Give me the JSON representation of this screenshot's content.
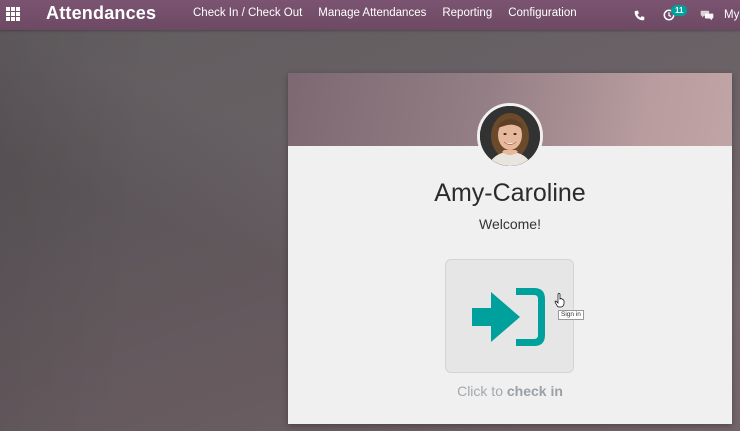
{
  "navbar": {
    "app_title": "Attendances",
    "menu": [
      {
        "label": "Check In / Check Out"
      },
      {
        "label": "Manage Attendances"
      },
      {
        "label": "Reporting"
      },
      {
        "label": "Configuration"
      }
    ],
    "activity_count": "11",
    "user_label": "My"
  },
  "card": {
    "employee_name": "Amy-Caroline",
    "welcome": "Welcome!",
    "hint_prefix": "Click to ",
    "hint_action": "check in",
    "tooltip": "Sign in"
  },
  "colors": {
    "navbar": "#714B67",
    "accent_teal": "#00A09D",
    "badge": "#00A09D"
  },
  "icons": {
    "apps": "apps-grid-icon",
    "phone": "phone-icon",
    "activity": "clock-icon",
    "chat": "chat-icon",
    "checkin": "sign-in-icon"
  }
}
